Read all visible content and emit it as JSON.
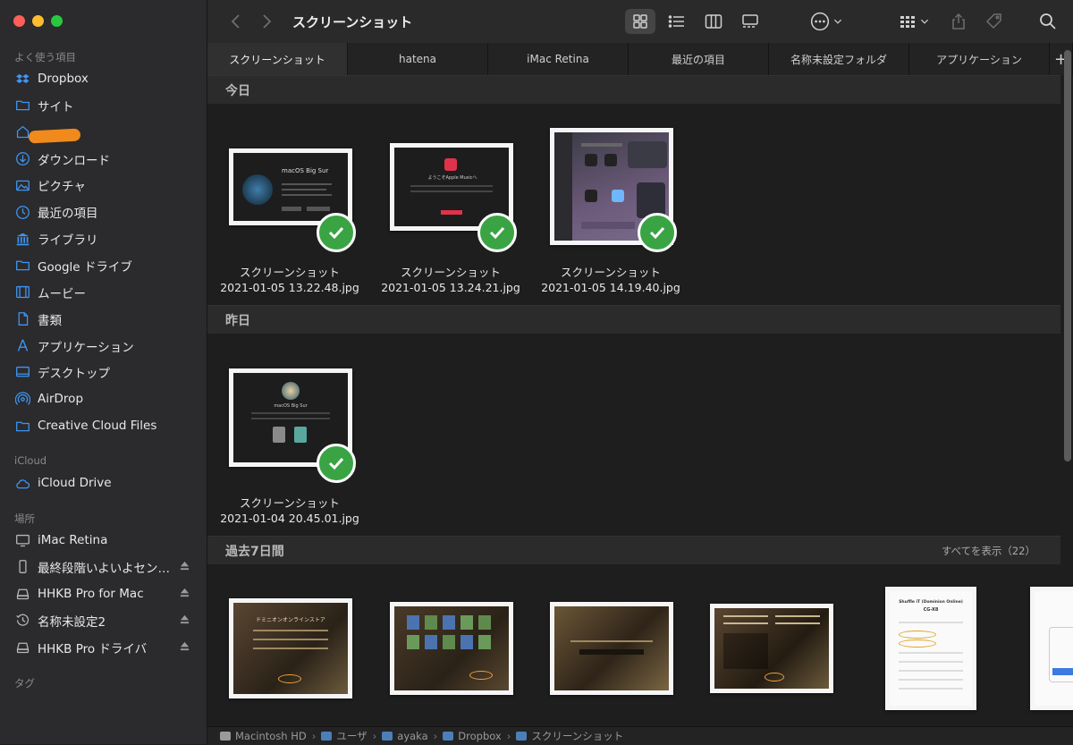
{
  "window": {
    "title": "スクリーンショット"
  },
  "sidebar": {
    "favorites_label": "よく使う項目",
    "favorites": [
      {
        "label": "Dropbox",
        "icon": "dropbox-icon"
      },
      {
        "label": "サイト",
        "icon": "folder-icon"
      },
      {
        "label": "",
        "icon": "home-icon"
      },
      {
        "label": "ダウンロード",
        "icon": "download-icon"
      },
      {
        "label": "ピクチャ",
        "icon": "pictures-icon"
      },
      {
        "label": "最近の項目",
        "icon": "clock-icon"
      },
      {
        "label": "ライブラリ",
        "icon": "library-icon"
      },
      {
        "label": "Google ドライブ",
        "icon": "folder-icon"
      },
      {
        "label": "ムービー",
        "icon": "film-icon"
      },
      {
        "label": "書類",
        "icon": "document-icon"
      },
      {
        "label": "アプリケーション",
        "icon": "applications-icon"
      },
      {
        "label": "デスクトップ",
        "icon": "desktop-icon"
      },
      {
        "label": "AirDrop",
        "icon": "airdrop-icon"
      },
      {
        "label": "Creative Cloud Files",
        "icon": "folder-icon"
      }
    ],
    "icloud_label": "iCloud",
    "icloud": [
      {
        "label": "iCloud Drive",
        "icon": "cloud-icon"
      }
    ],
    "locations_label": "場所",
    "locations": [
      {
        "label": "iMac Retina",
        "icon": "computer-icon",
        "eject": false
      },
      {
        "label": "最終段階いよいよセン…",
        "icon": "phone-icon",
        "eject": true
      },
      {
        "label": "HHKB Pro for Mac",
        "icon": "disk-icon",
        "eject": true
      },
      {
        "label": "名称未設定2",
        "icon": "timemachine-icon",
        "eject": true
      },
      {
        "label": "HHKB Pro ドライバ",
        "icon": "disk-icon",
        "eject": true
      }
    ],
    "tags_label": "タグ"
  },
  "tabs": [
    {
      "label": "スクリーンショット",
      "active": true
    },
    {
      "label": "hatena",
      "active": false
    },
    {
      "label": "iMac Retina",
      "active": false
    },
    {
      "label": "最近の項目",
      "active": false
    },
    {
      "label": "名称未設定フォルダ",
      "active": false
    },
    {
      "label": "アプリケーション",
      "active": false
    }
  ],
  "tab_add_label": "+",
  "groups": {
    "today": {
      "header": "今日",
      "files": [
        {
          "name": "スクリーンショット",
          "date": "2021-01-05 13.22.48.jpg"
        },
        {
          "name": "スクリーンショット",
          "date": "2021-01-05 13.24.21.jpg"
        },
        {
          "name": "スクリーンショット",
          "date": "2021-01-05 14.19.40.jpg"
        }
      ]
    },
    "yesterday": {
      "header": "昨日",
      "files": [
        {
          "name": "スクリーンショット",
          "date": "2021-01-04 20.45.01.jpg"
        }
      ]
    },
    "past7": {
      "header": "過去7日間",
      "show_all": "すべてを表示（22）"
    }
  },
  "thumb_text": {
    "macos_big_sur": "macOS Big Sur",
    "apple_music": "ようこそApple Musicへ",
    "store_title": "ドミニオンオンラインストア",
    "shuffle_title": "Shuffle iT (Dominion Online)",
    "shuffle_id": "CG-X8"
  },
  "pathbar": [
    {
      "label": "Macintosh HD",
      "kind": "hd"
    },
    {
      "label": "ユーザ",
      "kind": "folder"
    },
    {
      "label": "ayaka",
      "kind": "folder"
    },
    {
      "label": "Dropbox",
      "kind": "folder"
    },
    {
      "label": "スクリーンショット",
      "kind": "folder"
    }
  ],
  "colors": {
    "accent": "#3d96f5",
    "check": "#3aa444",
    "redaction": "#f08a1c"
  }
}
